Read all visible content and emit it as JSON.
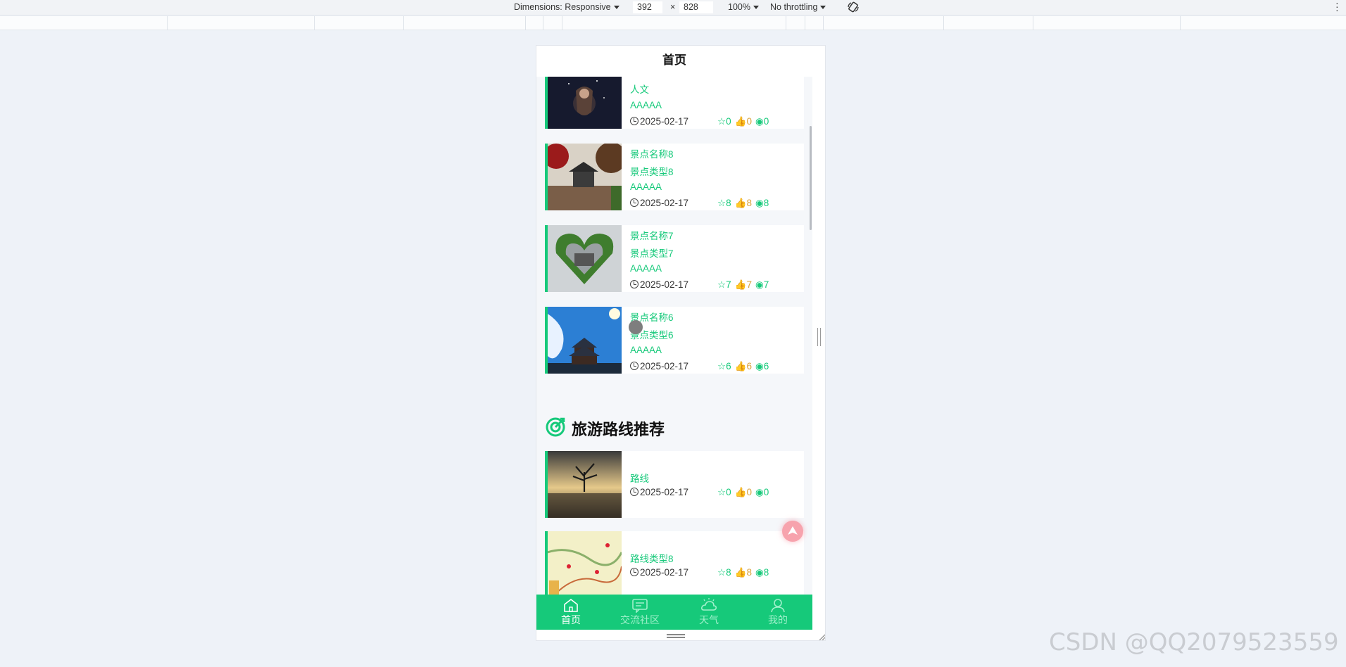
{
  "devtools": {
    "dimensions_label": "Dimensions: Responsive",
    "width": "392",
    "times": "×",
    "height": "828",
    "zoom": "100%",
    "throttling": "No throttling"
  },
  "page": {
    "title": "首页"
  },
  "spots": [
    {
      "name": "",
      "type": "人文",
      "level": "AAAAA",
      "date": "2025-02-17",
      "fav": "0",
      "like": "0",
      "view": "0"
    },
    {
      "name": "景点名称8",
      "type": "景点类型8",
      "level": "AAAAA",
      "date": "2025-02-17",
      "fav": "8",
      "like": "8",
      "view": "8"
    },
    {
      "name": "景点名称7",
      "type": "景点类型7",
      "level": "AAAAA",
      "date": "2025-02-17",
      "fav": "7",
      "like": "7",
      "view": "7"
    },
    {
      "name": "景点名称6",
      "type": "景点类型6",
      "level": "AAAAA",
      "date": "2025-02-17",
      "fav": "6",
      "like": "6",
      "view": "6"
    }
  ],
  "routes_section": {
    "title": "旅游路线推荐"
  },
  "routes": [
    {
      "type": "路线",
      "date": "2025-02-17",
      "fav": "0",
      "like": "0",
      "view": "0"
    },
    {
      "type": "路线类型8",
      "date": "2025-02-17",
      "fav": "8",
      "like": "8",
      "view": "8"
    }
  ],
  "tabbar": [
    {
      "label": "首页",
      "icon": "home-icon",
      "active": true
    },
    {
      "label": "交流社区",
      "icon": "chat-icon",
      "active": false
    },
    {
      "label": "天气",
      "icon": "weather-icon",
      "active": false
    },
    {
      "label": "我的",
      "icon": "user-icon",
      "active": false
    }
  ],
  "watermark": "CSDN @QQ2079523559",
  "colors": {
    "accent": "#16c97a",
    "gold": "#d9a13b",
    "fab": "#f7a3ad"
  }
}
